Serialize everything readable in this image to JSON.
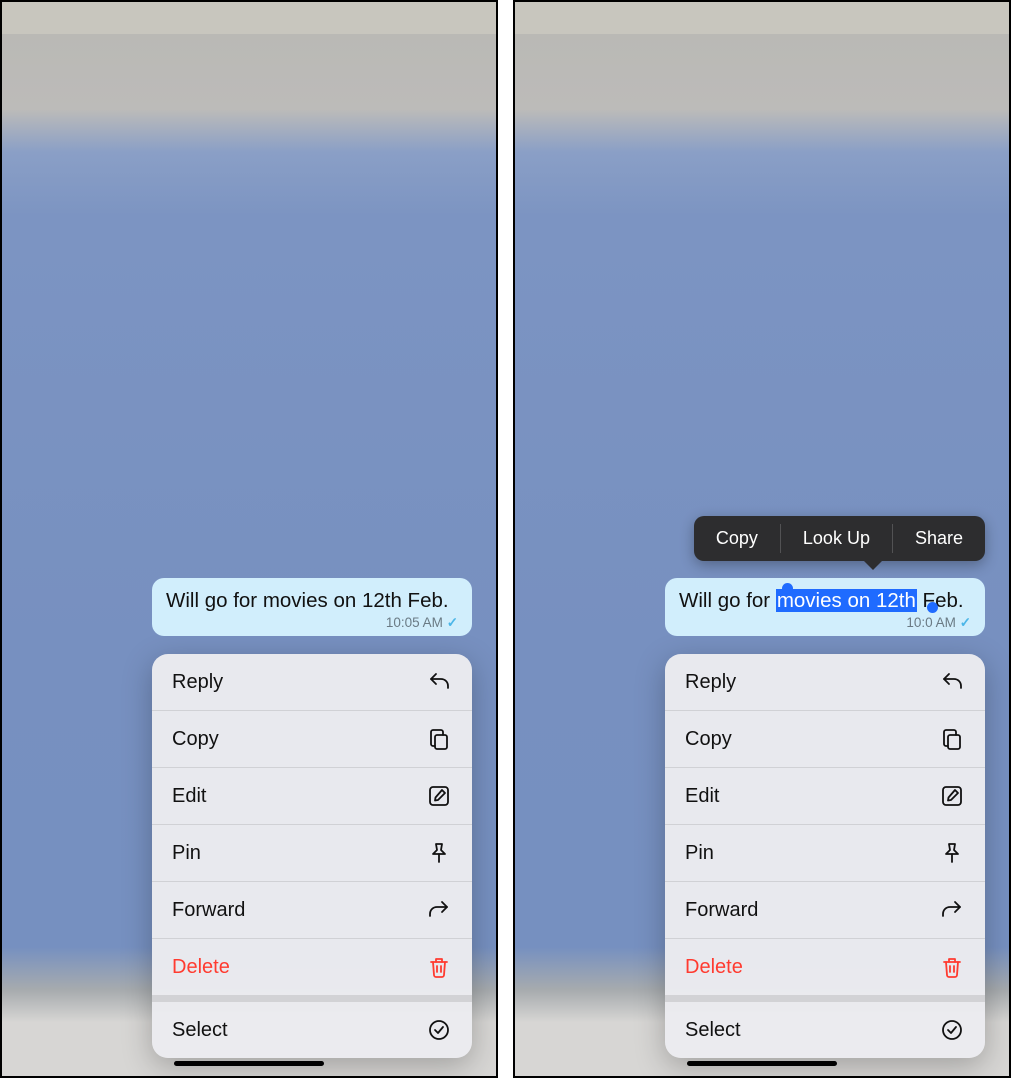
{
  "message": {
    "text_pre": "Will go for ",
    "text_sel": "movies on 12th",
    "text_post": " Feb.",
    "text_full": "Will go for movies on 12th Feb.",
    "time": "10:05 AM",
    "time_obscured": "10:0   AM"
  },
  "context_menu": {
    "reply": "Reply",
    "copy": "Copy",
    "edit": "Edit",
    "pin": "Pin",
    "forward": "Forward",
    "delete": "Delete",
    "select": "Select"
  },
  "selection_callout": {
    "copy": "Copy",
    "lookup": "Look Up",
    "share": "Share"
  }
}
